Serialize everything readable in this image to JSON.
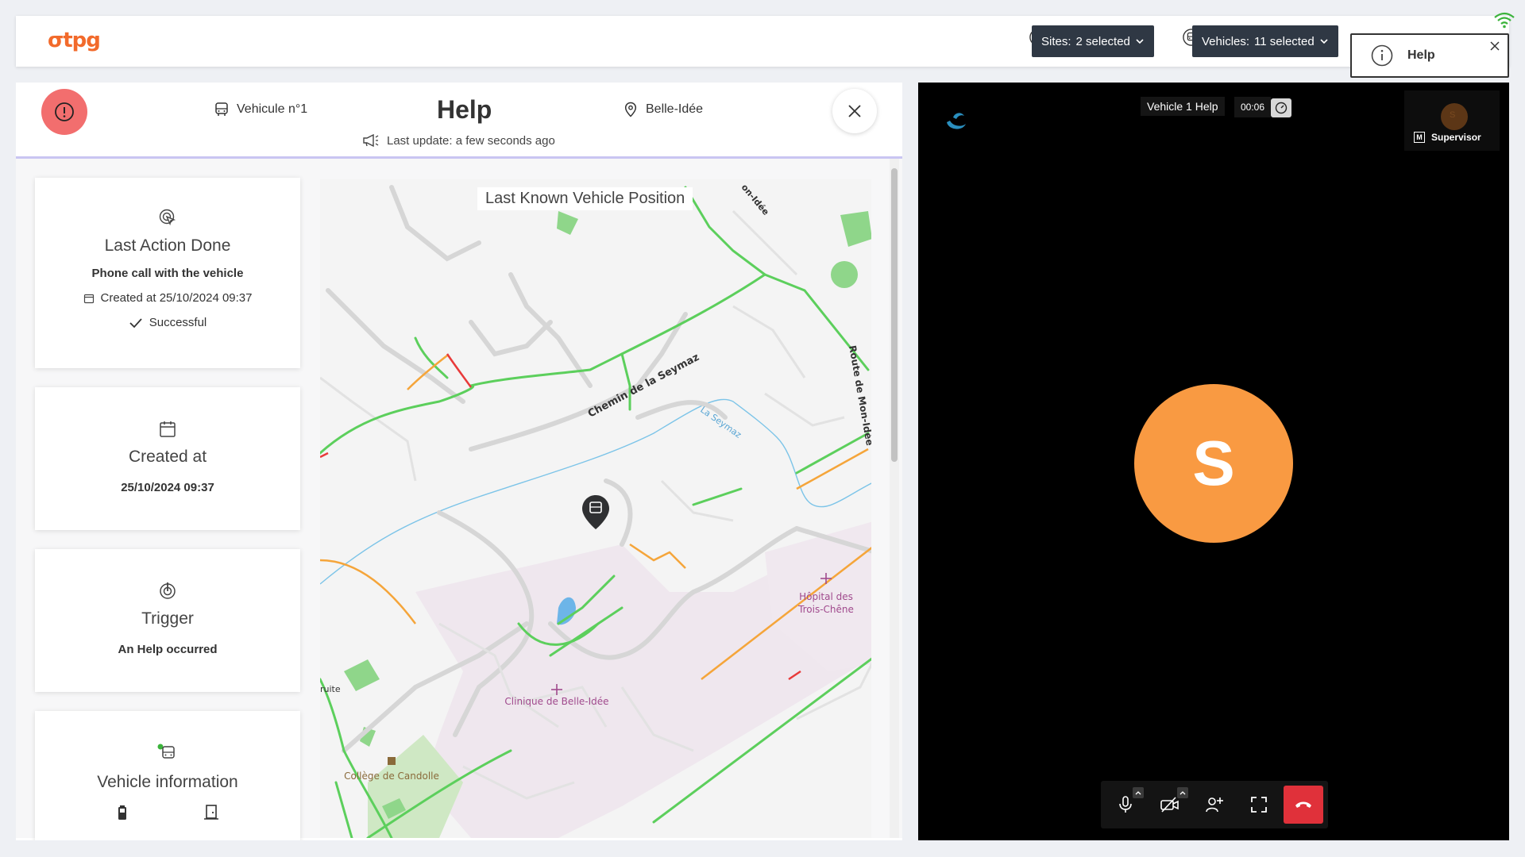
{
  "app": {
    "logo": "σtpg"
  },
  "filters": {
    "sites_label": "Sites:",
    "sites_value": "2 selected",
    "vehicles_label": "Vehicles:",
    "vehicles_value": "11 selected"
  },
  "toast": {
    "label": "Help"
  },
  "help": {
    "title": "Help",
    "vehicle": "Vehicule n°1",
    "site": "Belle-Idée",
    "last_update": "Last update: a few seconds ago"
  },
  "cards": {
    "last_action": {
      "title": "Last Action Done",
      "action": "Phone call with the vehicle",
      "created": "Created at 25/10/2024 09:37",
      "status": "Successful"
    },
    "created": {
      "title": "Created at",
      "value": "25/10/2024 09:37"
    },
    "trigger": {
      "title": "Trigger",
      "value": "An Help occurred"
    },
    "vehicle_info": {
      "title": "Vehicle information"
    }
  },
  "map": {
    "title": "Last Known Vehicle Position",
    "labels": {
      "road1": "Chemin de la Seymaz",
      "river": "La Seymaz",
      "road2": "Route de Mon-Idée",
      "top_road": "on-Idée",
      "hospital1": "Hôpital des",
      "hospital2": "Trois-Chêne",
      "clinic": "Clinique de Belle-Idée",
      "college": "Collège de Candolle",
      "edge": "ruite"
    }
  },
  "video": {
    "title": "Vehicle 1 Help",
    "timer": "00:06",
    "participant": "Supervisor",
    "participant_badge": "M",
    "mini_initial": "S",
    "avatar_initial": "S"
  },
  "colors": {
    "accent": "#f26a2b",
    "alert": "#f26e6e",
    "avatar": "#f99a42",
    "hangup": "#e0313a"
  }
}
